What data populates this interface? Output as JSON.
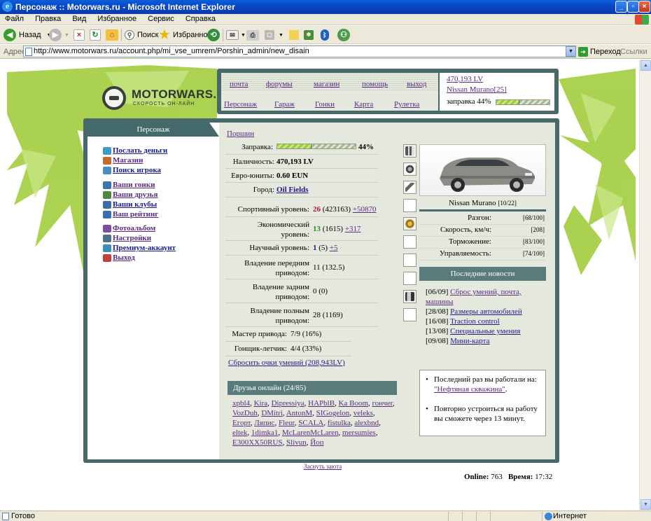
{
  "window": {
    "title": "Персонаж :: Motorwars.ru - Microsoft Internet Explorer"
  },
  "menu": [
    "Файл",
    "Правка",
    "Вид",
    "Избранное",
    "Сервис",
    "Справка"
  ],
  "toolbar": {
    "back": "Назад",
    "search": "Поиск",
    "favorites": "Избранное"
  },
  "address": {
    "label": "Адрес:",
    "url": "http://www.motorwars.ru/account.php/mi_vse_umrem/Porshin_admin/new_disain",
    "go": "Переход",
    "links": "Ссылки"
  },
  "site": {
    "logo": "MOTORWARS.RU",
    "tagline": "СКОРОСТЬ ОН-ЛАЙН",
    "nav_top": [
      "почта",
      "форумы",
      "магазин",
      "помощь",
      "выход"
    ],
    "nav_bottom": [
      "Персонаж",
      "Гараж",
      "Гонки",
      "Карта",
      "Рулетка"
    ],
    "status": {
      "money": "470,193 LV",
      "car": "Nissan Murano[25]",
      "fuel_label": "заправка 44%",
      "fuel_percent": 44
    }
  },
  "left": {
    "header": "Персонаж",
    "items": [
      {
        "label": "Послать деньги",
        "icon": "money-icon",
        "visited": false
      },
      {
        "label": "Магазин",
        "icon": "shop-icon",
        "visited": true
      },
      {
        "label": "Поиск игрока",
        "icon": "search-icon",
        "visited": false
      },
      {
        "label": "Ваши гонки",
        "icon": "race-icon",
        "visited": true
      },
      {
        "label": "Ваши друзья",
        "icon": "friends-icon",
        "visited": true
      },
      {
        "label": "Ваши клубы",
        "icon": "clubs-icon",
        "visited": false
      },
      {
        "label": "Ваш рейтинг",
        "icon": "rating-icon",
        "visited": true
      },
      {
        "label": "Фотоальбом",
        "icon": "photo-icon",
        "visited": true
      },
      {
        "label": "Настройки",
        "icon": "settings-icon",
        "visited": true
      },
      {
        "label": "Премиум-аккаунт",
        "icon": "premium-icon",
        "visited": false
      },
      {
        "label": "Выход",
        "icon": "exit-icon",
        "visited": true
      }
    ]
  },
  "character": {
    "name": "Поршин",
    "fuel_label": "Заправка:",
    "fuel_value": "44%",
    "fuel_percent": 44,
    "cash_label": "Наличность:",
    "cash_value": "470,193 LV",
    "euro_label": "Евро-юниты:",
    "euro_value": "0.60 EUN",
    "city_label": "Город:",
    "city_value": "Oil Fields",
    "sport_label": "Спортивный уровень:",
    "sport_level": "26",
    "sport_points": "(423163)",
    "sport_plus": "+50870",
    "econ_label": "Экономический уровень:",
    "econ_level": "13",
    "econ_points": "(1615)",
    "econ_plus": "+317",
    "sci_label": "Научный уровень:",
    "sci_level": "1",
    "sci_points": "(5)",
    "sci_plus": "+5",
    "fwd_label": "Владение передним приводом:",
    "fwd_value": "11 (132.5)",
    "rwd_label": "Владение задним приводом:",
    "rwd_value": "0 (0)",
    "awd_label": "Владение полным приводом:",
    "awd_value": "28 (1169)",
    "master_label": "Мастер привода:",
    "master_value": "7/9 (16%)",
    "pilot_label": "Гонщик-летчик:",
    "pilot_value": "4/4 (33%)",
    "reset_link": "Сбросить очки умений (208,943LV)"
  },
  "car": {
    "name": "Nissan Murano",
    "tag": "[10/22]",
    "stats": [
      {
        "label": "Разгон:",
        "value": "[68/100]"
      },
      {
        "label": "Скорость, км/ч:",
        "value": "[208]"
      },
      {
        "label": "Торможение:",
        "value": "[83/100]"
      },
      {
        "label": "Управляемость:",
        "value": "[74/100]"
      }
    ]
  },
  "news": {
    "header": "Последние новости",
    "items": [
      {
        "date": "[06/09]",
        "title": "Сброс умений, почта, машины"
      },
      {
        "date": "[28/08]",
        "title": "Размеры автомобилей"
      },
      {
        "date": "[16/08]",
        "title": "Traction control"
      },
      {
        "date": "[13/08]",
        "title": "Специальные умения"
      },
      {
        "date": "[09/08]",
        "title": "Мини-карта"
      }
    ]
  },
  "work": {
    "line1": "Последний раз вы работали на:",
    "place": "\"Нефтяная скважина\"",
    "line2": "Повторно устроиться на работу вы сможете через 13 минут."
  },
  "friends": {
    "header": "Друзья онлайн (24/85)",
    "names": [
      "xpbl4",
      "Kira",
      "Dipressiya",
      "HAPblB",
      "Ka Boom",
      "гончег",
      "VozDuh",
      "DMitri",
      "AntonM",
      "SIGogelon",
      "veleks",
      "Егорт",
      "Ляпис",
      "Fleur",
      "SCALA",
      "fistulka",
      "alexbnd",
      "eltek",
      "1dimka1",
      "McLarenMcLaren",
      "mersumies",
      "E300XX50RUS",
      "Slivun",
      "Йоп"
    ]
  },
  "footer": {
    "bottom_link": "Заснуть заюта",
    "online_label": "Online:",
    "online_value": "763",
    "time_label": "Время:",
    "time_value": "17:32"
  },
  "statusbar": {
    "ready": "Готово",
    "zone": "Интернет"
  },
  "colors": {
    "frame": "#49686a",
    "panel_bg": "#e4e8dd",
    "grass": "#9ccb32",
    "link": "#1b1b8a",
    "visited": "#5b2a86"
  }
}
